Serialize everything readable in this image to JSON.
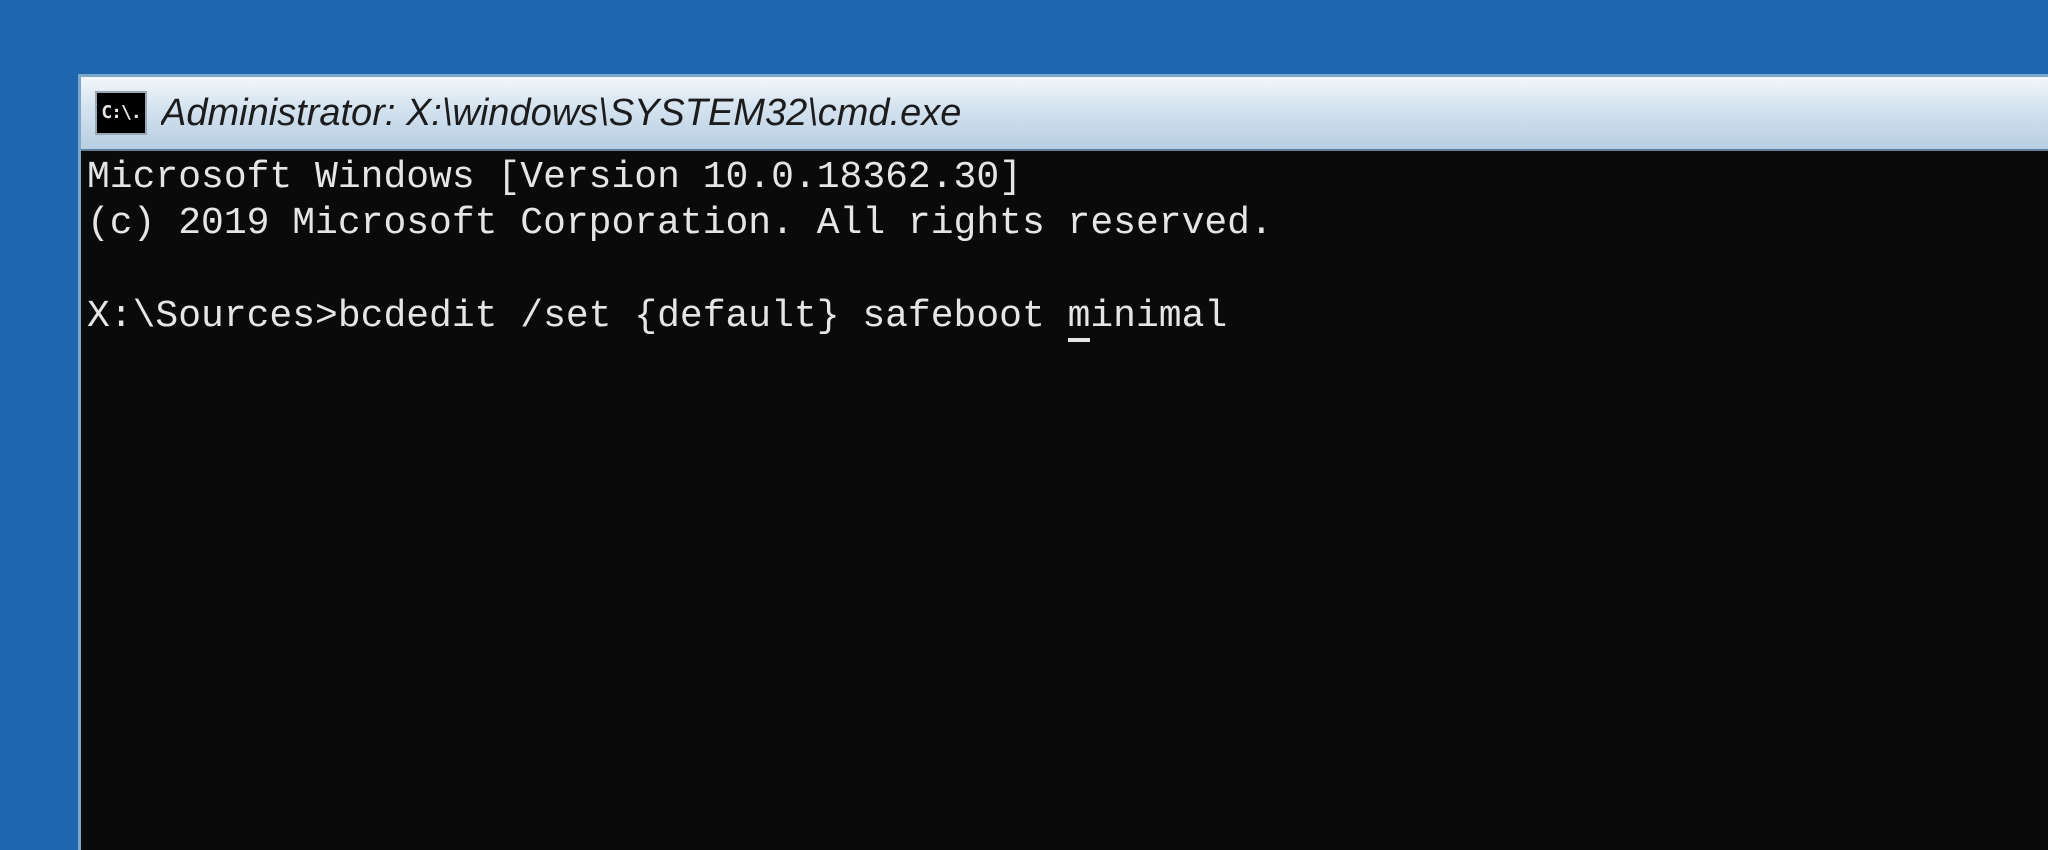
{
  "window": {
    "icon_glyph": "C:\\.",
    "title": "Administrator: X:\\windows\\SYSTEM32\\cmd.exe"
  },
  "terminal": {
    "banner_line1": "Microsoft Windows [Version 10.0.18362.30]",
    "banner_line2": "(c) 2019 Microsoft Corporation. All rights reserved.",
    "blank_line": "",
    "prompt": "X:\\Sources>",
    "command_before_cursor": "bcdedit /set {default} safeboot ",
    "command_cursor_char": "m",
    "command_after_cursor": "inimal"
  }
}
